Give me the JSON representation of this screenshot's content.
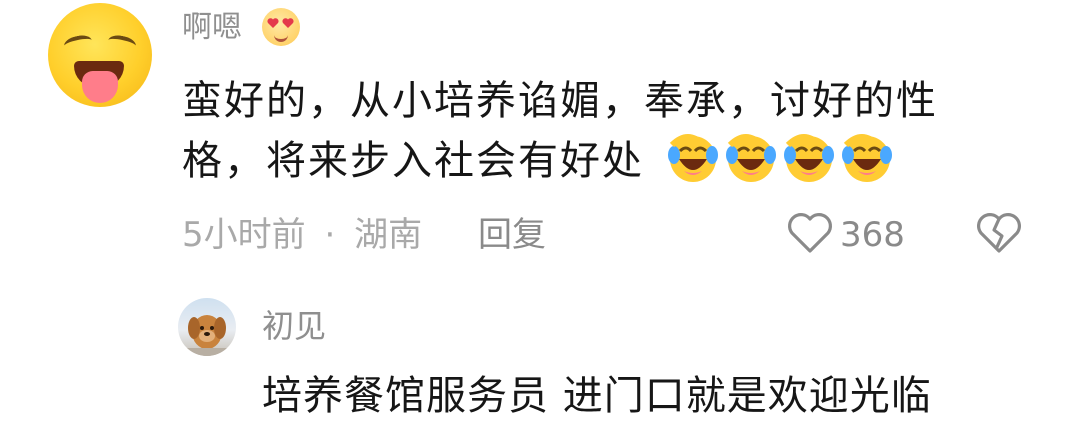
{
  "comment": {
    "username": "啊嗯",
    "username_emoji": "heart-eyes-emoji",
    "text_line1": "蛮好的，从小培养谄媚，奉承，讨好的性",
    "text_line2": "格，将来步入社会有好处",
    "trailing_emojis": [
      "laughing-crying-emoji",
      "laughing-crying-emoji",
      "laughing-crying-emoji",
      "laughing-crying-emoji"
    ],
    "time": "5小时前",
    "separator": "·",
    "location": "湖南",
    "reply_label": "回复",
    "like_count": "368",
    "like_icon": "heart-outline-icon",
    "dislike_icon": "broken-heart-icon"
  },
  "reply": {
    "username": "初见",
    "text": "培养餐馆服务员 进门口就是欢迎光临",
    "avatar": "dog-photo-avatar"
  },
  "colors": {
    "primary_text": "#161616",
    "secondary_text": "#8f8f8f",
    "meta_text": "#a9a9a9",
    "background": "#ffffff"
  }
}
